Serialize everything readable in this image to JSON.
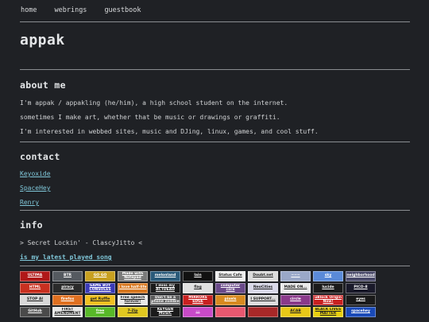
{
  "nav": [
    {
      "label": "home"
    },
    {
      "label": "webrings"
    },
    {
      "label": "guestbook"
    }
  ],
  "site_title": "appak",
  "about": {
    "heading": "about me",
    "lines": [
      "I'm appak / appakling (he/him), a high school student on the internet.",
      "sometimes I make art, whether that be music or drawings or graffiti.",
      "I'm interested in webbed sites, music and DJing, linux, games, and cool stuff."
    ]
  },
  "contact": {
    "heading": "contact",
    "links": [
      "Keyoxide",
      "SpaceHey",
      "Renry"
    ]
  },
  "info": {
    "heading": "info",
    "now_playing": "> Secret Lockin' - ClascyJitto <",
    "latest_link": "is my latest played song"
  },
  "buttons": [
    [
      {
        "name": "ultima",
        "text": "ULTIMA",
        "bg": "#b01818"
      },
      {
        "name": "btr",
        "text": "BTR",
        "bg": "#555a60"
      },
      {
        "name": "go-yoshi",
        "text": "GO GO",
        "bg": "#c8a020"
      },
      {
        "name": "made-with-notepad",
        "text": "Made with Notepad",
        "bg": "#7a7a7a"
      },
      {
        "name": "melonland",
        "text": "melonland",
        "bg": "#2a5a7a"
      },
      {
        "name": "lain",
        "text": "lain",
        "bg": "#111111"
      },
      {
        "name": "status-cafe",
        "text": "Status Cafe",
        "bg": "#f0f0f0"
      },
      {
        "name": "doubt-net",
        "text": "Doubt.net",
        "bg": "#dcdcdc"
      },
      {
        "name": "rainbow",
        "text": "~~~",
        "bg": "#9aa8c8"
      },
      {
        "name": "blue-sky",
        "text": "sky",
        "bg": "#5a8ad8"
      },
      {
        "name": "neighborhood",
        "text": "neighborhood",
        "bg": "#4a4a6a"
      }
    ],
    [
      {
        "name": "html",
        "text": "HTML",
        "bg": "#c83020"
      },
      {
        "name": "piracy",
        "text": "piracy",
        "bg": "#2a2a2a"
      },
      {
        "name": "gameboy-consoles",
        "text": "GAME BOY CONSOLES",
        "bg": "#3a3ab8"
      },
      {
        "name": "half-life",
        "text": "i love half-life",
        "bg": "#d87820"
      },
      {
        "name": "i-miss-my-actdead",
        "text": "I miss my ACTDEAD",
        "bg": "#1a1a1a"
      },
      {
        "name": "flag",
        "text": "flag",
        "bg": "#e0e0e0"
      },
      {
        "name": "computer-core",
        "text": "computer core",
        "bg": "#6a4a8a"
      },
      {
        "name": "neocities",
        "text": "NeoCities",
        "bg": "#d8d8e8"
      },
      {
        "name": "badge-9",
        "text": "MADE ON...",
        "bg": "#eaeaea"
      },
      {
        "name": "lucide",
        "text": "lucide",
        "bg": "#1a1a1a"
      },
      {
        "name": "pico-8",
        "text": "PICO-8",
        "bg": "#1a1a2a"
      }
    ],
    [
      {
        "name": "stop-ai",
        "text": "STOP AI",
        "bg": "#d8d8d8"
      },
      {
        "name": "firefox",
        "text": "firefox",
        "bg": "#e07020"
      },
      {
        "name": "get-ruffle",
        "text": "get Ruffle",
        "bg": "#f0c020"
      },
      {
        "name": "free-speech",
        "text": "Free speech forever!",
        "bg": "#e8e8e8"
      },
      {
        "name": "phone",
        "text": "Don't be a phone zombie",
        "bg": "#5a5a5a"
      },
      {
        "name": "mirrors-edge",
        "text": "MIRRORS EDGE",
        "bg": "#c82020"
      },
      {
        "name": "pixels",
        "text": "pixels",
        "bg": "#d88a20"
      },
      {
        "name": "user-agent",
        "text": "I SUPPORT...",
        "bg": "#dcdcdc"
      },
      {
        "name": "circle",
        "text": "circle",
        "bg": "#8a3a8a"
      },
      {
        "name": "ublock-origin",
        "text": "uBlock Origin Now!",
        "bg": "#c82020"
      },
      {
        "name": "eyes",
        "text": "eyes",
        "bg": "#1a1a1a"
      }
    ],
    [
      {
        "name": "github",
        "text": "GitHub",
        "bg": "#4a4a4a"
      },
      {
        "name": "first-amendment",
        "text": "FIRST AMENDMENT",
        "bg": "#e8e8e8"
      },
      {
        "name": "free-software",
        "text": "free",
        "bg": "#58b828"
      },
      {
        "name": "7-zip",
        "text": "7-Zip",
        "bg": "#e0c820"
      },
      {
        "name": "keygen-music",
        "text": "KEYGEN MUSIC",
        "bg": "#1a1a1a"
      },
      {
        "name": "vaporwave",
        "text": "...",
        "bg": "#c84ac8"
      },
      {
        "name": "pink-bar",
        "text": "",
        "bg": "#e85870"
      },
      {
        "name": "red-rectangles",
        "text": "",
        "bg": "#a82828"
      },
      {
        "name": "acab",
        "text": "ACAB",
        "bg": "#e8c818"
      },
      {
        "name": "black-lives-matter",
        "text": "BLACK LIVES MATTER",
        "bg": "#e8d010"
      },
      {
        "name": "spacehey-btn",
        "text": "spacehey",
        "bg": "#1a4ab8"
      }
    ]
  ]
}
